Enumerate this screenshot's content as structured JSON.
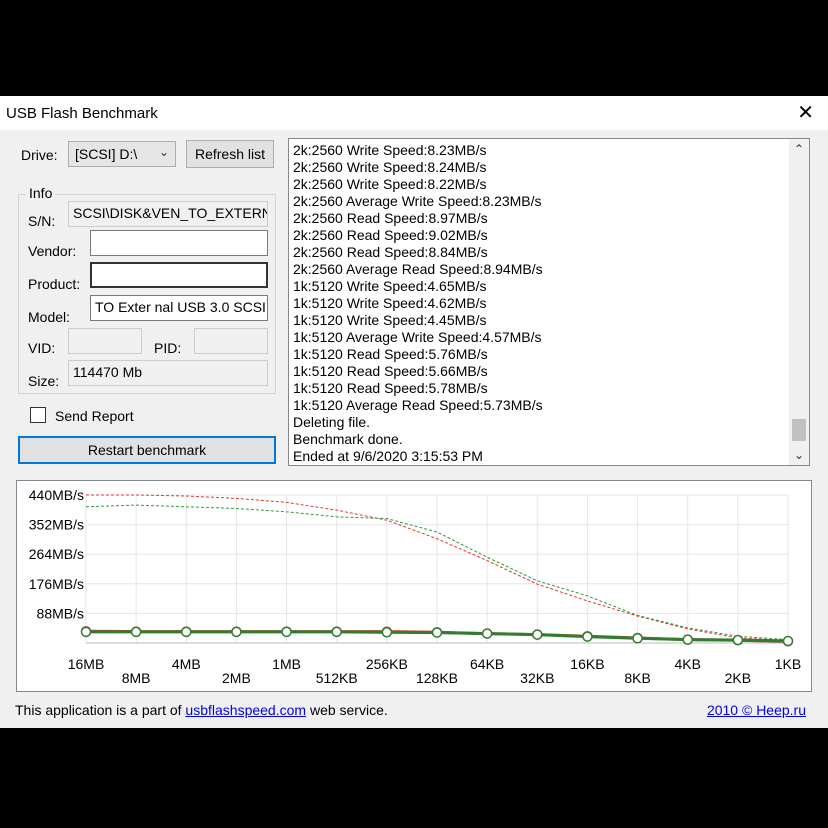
{
  "window": {
    "title": "USB Flash Benchmark"
  },
  "drive": {
    "label": "Drive:",
    "value": "[SCSI] D:\\",
    "refresh_label": "Refresh list"
  },
  "info": {
    "legend": "Info",
    "sn_label": "S/N:",
    "sn_value": "SCSI\\DISK&VEN_TO_EXTERNAL",
    "vendor_label": "Vendor:",
    "vendor_value": "",
    "product_label": "Product:",
    "product_value": "",
    "model_label": "Model:",
    "model_value": "TO Exter nal USB 3.0 SCSI",
    "vid_label": "VID:",
    "vid_value": "",
    "pid_label": "PID:",
    "pid_value": "",
    "size_label": "Size:",
    "size_value": "114470 Mb"
  },
  "send_report": {
    "label": "Send Report",
    "checked": false
  },
  "restart_label": "Restart benchmark",
  "log": [
    "2k:2560 Write Speed:8.23MB/s",
    "2k:2560 Write Speed:8.24MB/s",
    "2k:2560 Write Speed:8.22MB/s",
    "2k:2560 Average Write Speed:8.23MB/s",
    "2k:2560 Read Speed:8.97MB/s",
    "2k:2560 Read Speed:9.02MB/s",
    "2k:2560 Read Speed:8.84MB/s",
    "2k:2560 Average Read Speed:8.94MB/s",
    "1k:5120 Write Speed:4.65MB/s",
    "1k:5120 Write Speed:4.62MB/s",
    "1k:5120 Write Speed:4.45MB/s",
    "1k:5120 Average Write Speed:4.57MB/s",
    "1k:5120 Read Speed:5.76MB/s",
    "1k:5120 Read Speed:5.66MB/s",
    "1k:5120 Read Speed:5.78MB/s",
    "1k:5120 Average Read Speed:5.73MB/s",
    "Deleting file.",
    "Benchmark done.",
    "Ended at 9/6/2020 3:15:53 PM"
  ],
  "chart_data": {
    "type": "line",
    "categories": [
      "16MB",
      "8MB",
      "4MB",
      "2MB",
      "1MB",
      "512KB",
      "256KB",
      "128KB",
      "64KB",
      "32KB",
      "16KB",
      "8KB",
      "4KB",
      "2KB",
      "1KB"
    ],
    "ylim": [
      0,
      440
    ],
    "y_ticks": [
      "440MB/s",
      "352MB/s",
      "264MB/s",
      "176MB/s",
      "88MB/s"
    ],
    "y_tick_values": [
      440,
      352,
      264,
      176,
      88
    ],
    "grid": true,
    "series": [
      {
        "style": "dashed",
        "color": "#e53935",
        "values": [
          440,
          440,
          437,
          430,
          418,
          395,
          365,
          310,
          245,
          175,
          125,
          80,
          42,
          15,
          8
        ]
      },
      {
        "style": "dashed",
        "color": "#2e9e3e",
        "values": [
          405,
          410,
          405,
          400,
          390,
          375,
          370,
          330,
          255,
          185,
          140,
          82,
          45,
          20,
          10
        ]
      },
      {
        "style": "solid",
        "color": "#d33a2c",
        "values": [
          35,
          34,
          34,
          34,
          34,
          34,
          34,
          32,
          28,
          25,
          20,
          15,
          10,
          8,
          5
        ]
      },
      {
        "style": "solid",
        "color": "#2e7d32",
        "values": [
          33,
          33,
          33,
          33,
          33,
          33,
          32,
          31,
          28,
          25,
          19,
          14,
          10,
          9,
          6
        ]
      }
    ]
  },
  "footer": {
    "text_before": "This application is a part of ",
    "link": "usbflashspeed.com",
    "text_after": " web service.",
    "copyright_link": "2010 © Heep.ru"
  },
  "colors": {
    "accent": "#0078d7",
    "link": "#0000ee",
    "window_bg": "#f0f0f0"
  }
}
